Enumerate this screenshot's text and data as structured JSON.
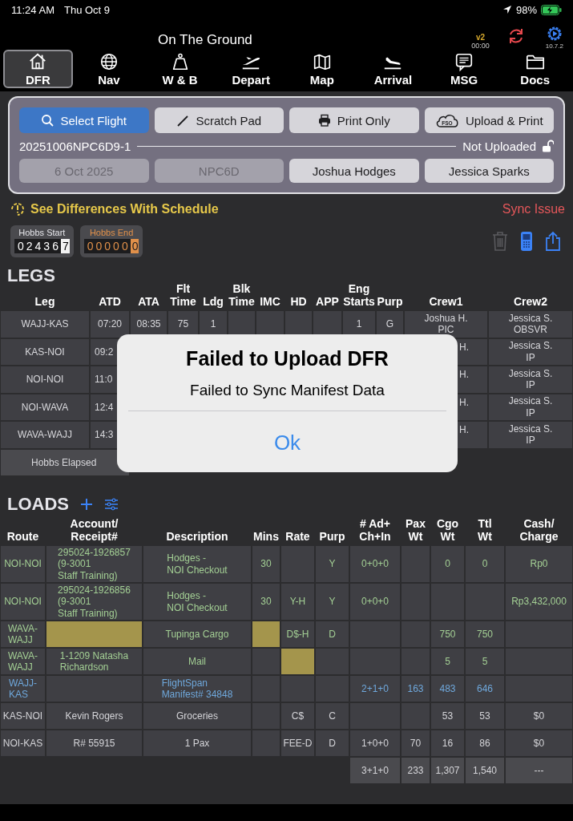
{
  "status_bar": {
    "time": "11:24 AM",
    "date": "Thu Oct 9",
    "battery": "98%"
  },
  "header": {
    "title": "On The Ground",
    "version": "v2",
    "timer": "00:00",
    "app_version": "10.7.2"
  },
  "tabs": [
    {
      "label": "DFR",
      "selected": true
    },
    {
      "label": "Nav",
      "selected": false
    },
    {
      "label": "W & B",
      "selected": false
    },
    {
      "label": "Depart",
      "selected": false
    },
    {
      "label": "Map",
      "selected": false
    },
    {
      "label": "Arrival",
      "selected": false
    },
    {
      "label": "MSG",
      "selected": false
    },
    {
      "label": "Docs",
      "selected": false
    }
  ],
  "flight_panel": {
    "actions": [
      {
        "label": "Select Flight",
        "selected": true
      },
      {
        "label": "Scratch Pad",
        "selected": false
      },
      {
        "label": "Print Only",
        "selected": false
      },
      {
        "label": "Upload & Print",
        "selected": false,
        "icon_text": "FSO"
      }
    ],
    "flight_id": "20251006NPC6D9-1",
    "upload_status": "Not Uploaded",
    "locked": false,
    "fields": [
      {
        "value": "6 Oct 2025",
        "disabled": true
      },
      {
        "value": "NPC6D",
        "disabled": true
      },
      {
        "value": "Joshua Hodges",
        "disabled": false
      },
      {
        "value": "Jessica Sparks",
        "disabled": false
      }
    ]
  },
  "notices": {
    "differences": "See Differences With Schedule",
    "sync": "Sync Issue"
  },
  "hobbs": [
    {
      "label": "Hobbs Start",
      "kind": "start",
      "digits": "02436",
      "tenths": "7"
    },
    {
      "label": "Hobbs End",
      "kind": "end",
      "digits": "00000",
      "tenths": "0"
    }
  ],
  "tools": {
    "delete_disabled": true
  },
  "legs": {
    "title": "LEGS",
    "columns": [
      "Leg",
      "ATD",
      "ATA",
      "Flt\nTime",
      "Ldg",
      "Blk\nTime",
      "IMC",
      "HD",
      "APP",
      "Eng\nStarts",
      "Purp",
      "Crew1",
      "Crew2"
    ],
    "rows": [
      {
        "leg": "WAJJ-KAS",
        "atd": "07:20",
        "ata": "08:35",
        "flt_time": "75",
        "ldg": "1",
        "eng_starts": "1",
        "purp": "G",
        "crew1": "Joshua H.\nPIC",
        "crew2": "Jessica S.\nOBSVR"
      },
      {
        "leg": "KAS-NOI",
        "atd": {
          "text": "09:2",
          "cut_end": true
        },
        "crew1": {
          "text": "H.",
          "cut_start": true
        },
        "crew2": "Jessica S.\nIP"
      },
      {
        "leg": "NOI-NOI",
        "atd": {
          "text": "11:0",
          "cut_end": true
        },
        "crew1": {
          "text": "H.",
          "cut_start": true
        },
        "crew2": "Jessica S.\nIP"
      },
      {
        "leg": "NOI-WAVA",
        "atd": {
          "text": "12:4",
          "cut_end": true
        },
        "crew1": {
          "text": "H.",
          "cut_start": true
        },
        "crew2": "Jessica S.\nIP"
      },
      {
        "leg": "WAVA-WAJJ",
        "atd": {
          "text": "14:3",
          "cut_end": true
        },
        "crew1": {
          "text": "H.",
          "cut_start": true
        },
        "crew2": "Jessica S.\nIP"
      }
    ],
    "footer": "Hobbs Elapsed"
  },
  "dialog": {
    "title": "Failed to Upload DFR",
    "message": "Failed to Sync Manifest Data",
    "button": "Ok"
  },
  "loads": {
    "title": "LOADS",
    "columns": [
      "Route",
      "Account/\nReceipt#",
      "Description",
      "Mins",
      "Rate",
      "Purp",
      "# Ad+\nCh+In",
      "Pax\nWt",
      "Cgo\nWt",
      "Ttl\nWt",
      "Cash/\nCharge"
    ],
    "rows": [
      {
        "color": "#a3cf94",
        "cells": [
          {
            "text": "NOI-NOI",
            "flagged": false
          },
          {
            "text": "295024-1926857\n(9-3001\nStaff Training)",
            "flagged": false
          },
          {
            "text": "Hodges -\nNOI Checkout",
            "flagged": false
          },
          {
            "text": "30",
            "flagged": false
          },
          {
            "flagged": false
          },
          {
            "text": "Y",
            "flagged": false
          },
          {
            "text": "0+0+0",
            "flagged": false
          },
          {
            "flagged": false
          },
          {
            "text": "0",
            "flagged": false
          },
          {
            "text": "0",
            "flagged": false
          },
          {
            "text": "Rp0",
            "flagged": false
          }
        ]
      },
      {
        "color": "#a3cf94",
        "cells": [
          {
            "text": "NOI-NOI",
            "flagged": false
          },
          {
            "text": "295024-1926856\n(9-3001\nStaff Training)",
            "flagged": false
          },
          {
            "text": "Hodges -\nNOI Checkout",
            "flagged": false
          },
          {
            "text": "30",
            "flagged": false
          },
          {
            "text": "Y-H",
            "flagged": false
          },
          {
            "text": "Y",
            "flagged": false
          },
          {
            "text": "0+0+0",
            "flagged": false
          },
          {
            "flagged": false
          },
          {
            "flagged": false
          },
          {
            "flagged": false
          },
          {
            "text": "Rp3,432,000",
            "flagged": false
          }
        ]
      },
      {
        "color": "#a3cf94",
        "cells": [
          {
            "text": "WAVA-\nWAJJ",
            "flagged": false
          },
          {
            "flagged": true
          },
          {
            "text": "Tupinga Cargo",
            "flagged": false
          },
          {
            "flagged": true
          },
          {
            "text": "D$-H",
            "flagged": false
          },
          {
            "text": "D",
            "flagged": false
          },
          {
            "flagged": false
          },
          {
            "flagged": false
          },
          {
            "text": "750",
            "flagged": false
          },
          {
            "text": "750",
            "flagged": false
          },
          {
            "flagged": false
          }
        ]
      },
      {
        "color": "#a3cf94",
        "cells": [
          {
            "text": "WAVA-\nWAJJ",
            "flagged": false
          },
          {
            "text": "1-1209 Natasha\nRichardson",
            "flagged": false
          },
          {
            "text": "Mail",
            "flagged": false
          },
          {
            "flagged": false
          },
          {
            "flagged": true
          },
          {
            "flagged": false
          },
          {
            "flagged": false
          },
          {
            "flagged": false
          },
          {
            "text": "5",
            "flagged": false
          },
          {
            "text": "5",
            "flagged": false
          },
          {
            "flagged": false
          }
        ]
      },
      {
        "color": "#6fa8dc",
        "cells": [
          {
            "text": "WAJJ-\nKAS",
            "flagged": false
          },
          {
            "flagged": false
          },
          {
            "text": "FlightSpan\nManifest# 34848",
            "flagged": false
          },
          {
            "flagged": false
          },
          {
            "flagged": false
          },
          {
            "flagged": false
          },
          {
            "text": "2+1+0",
            "flagged": false
          },
          {
            "text": "163",
            "flagged": false
          },
          {
            "text": "483",
            "flagged": false
          },
          {
            "text": "646",
            "flagged": false
          },
          {
            "flagged": false
          }
        ]
      },
      {
        "color": "#d4d4d8",
        "cells": [
          {
            "text": "KAS-NOI",
            "flagged": false
          },
          {
            "text": "Kevin Rogers",
            "flagged": false
          },
          {
            "text": "Groceries",
            "flagged": false
          },
          {
            "flagged": false
          },
          {
            "text": "C$",
            "flagged": false
          },
          {
            "text": "C",
            "flagged": false
          },
          {
            "flagged": false
          },
          {
            "flagged": false
          },
          {
            "text": "53",
            "flagged": false
          },
          {
            "text": "53",
            "flagged": false
          },
          {
            "text": "$0",
            "flagged": false
          }
        ]
      },
      {
        "color": "#d4d4d8",
        "cells": [
          {
            "text": "NOI-KAS",
            "flagged": false
          },
          {
            "text": "R# 55915",
            "flagged": false
          },
          {
            "text": "1 Pax",
            "flagged": false
          },
          {
            "flagged": false
          },
          {
            "text": "FEE-D",
            "flagged": false
          },
          {
            "text": "D",
            "flagged": false
          },
          {
            "text": "1+0+0",
            "flagged": false
          },
          {
            "text": "70",
            "flagged": false
          },
          {
            "text": "16",
            "flagged": false
          },
          {
            "text": "86",
            "flagged": false
          },
          {
            "text": "$0",
            "flagged": false
          }
        ]
      }
    ],
    "totals": [
      "3+1+0",
      "233",
      "1,307",
      "1,540",
      "---"
    ]
  }
}
